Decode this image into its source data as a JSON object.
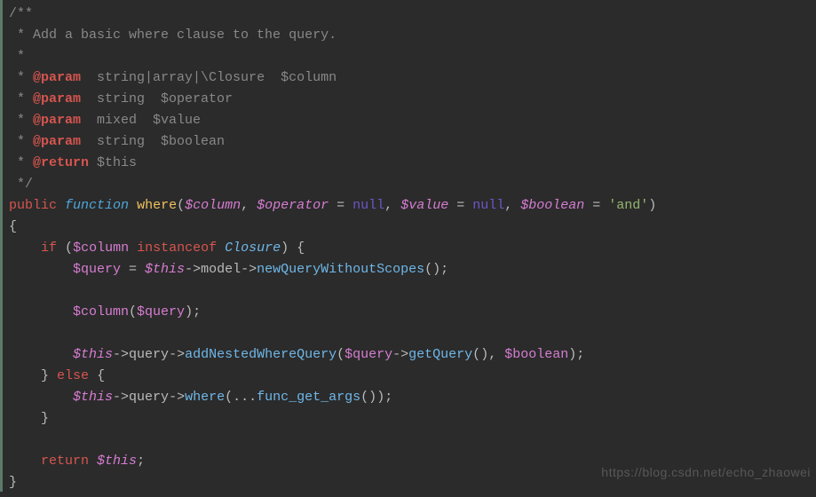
{
  "comment": {
    "l1": "/**",
    "l2_star": " * ",
    "l2_text": "Add a basic where clause to the query.",
    "l3": " *",
    "p_star": " * ",
    "tag_param": "@param",
    "tag_return": "@return",
    "p1": "  string|array|\\Closure  $column",
    "p2": "  string  $operator",
    "p3": "  mixed  $value",
    "p4": "  string  $boolean",
    "ret": " $this",
    "close": " */"
  },
  "sig": {
    "kw_public": "public",
    "kw_function": "function",
    "name": "where",
    "open": "(",
    "v_column": "$column",
    "v_operator": "$operator",
    "v_value": "$value",
    "v_boolean": "$boolean",
    "eq": " = ",
    "null": "null",
    "str_and": "'and'",
    "comma": ", ",
    "close": ")"
  },
  "body": {
    "brace_o": "{",
    "brace_c": "}",
    "if_kw": "if",
    "else_kw": "else",
    "instanceof_kw": "instanceof",
    "closure_cls": "Closure",
    "v_column": "$column",
    "v_query": "$query",
    "v_this": "$this",
    "v_boolean": "$boolean",
    "arrow": "->",
    "model": "model",
    "query_prop": "query",
    "m_newQuery": "newQueryWithoutScopes",
    "m_addNested": "addNestedWhereQuery",
    "m_getQuery": "getQuery",
    "m_where": "where",
    "m_fgargs": "func_get_args",
    "spread": "...",
    "return_kw": "return",
    "eq": " = ",
    "p_o": "(",
    "p_c": ")",
    "semi": ";",
    "comma": ", ",
    "indent1": "    ",
    "indent2": "        "
  },
  "watermark": "https://blog.csdn.net/echo_zhaowei"
}
